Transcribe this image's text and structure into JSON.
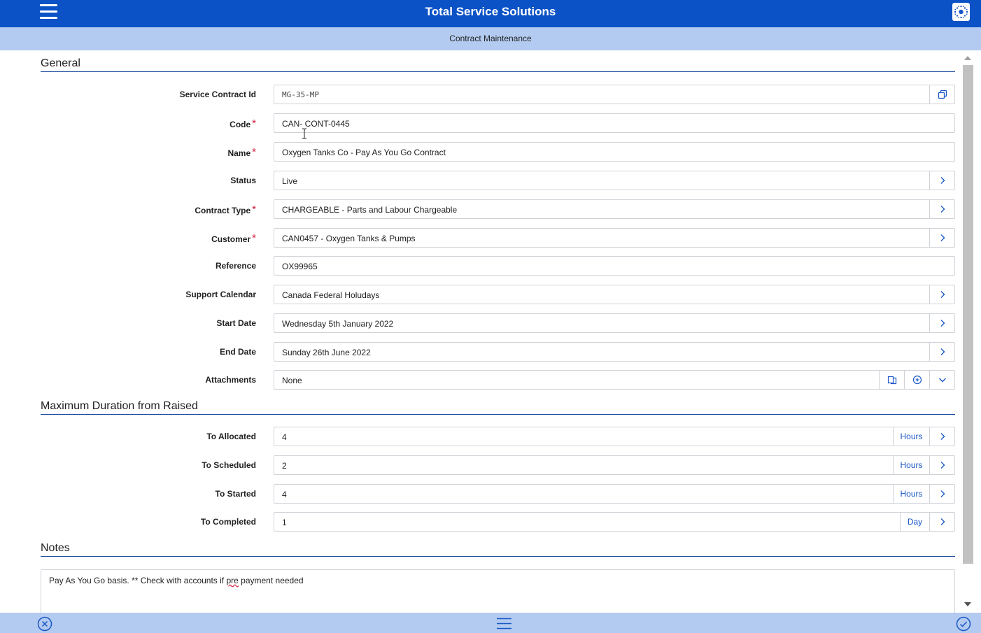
{
  "header": {
    "app_title": "Total Service Solutions",
    "logo_icon": "app-logo-icon",
    "menu_icon": "hamburger-menu-icon"
  },
  "subheader": {
    "title": "Contract Maintenance"
  },
  "sections": {
    "general": "General",
    "max_duration": "Maximum Duration from Raised",
    "notes": "Notes"
  },
  "general_fields": [
    {
      "label": "Service Contract Id",
      "value": "MG-35-MP",
      "required": false
    },
    {
      "label": "Code",
      "value": "CAN- CONT-0445",
      "required": true
    },
    {
      "label": "Name",
      "value": "Oxygen Tanks Co - Pay As You Go Contract",
      "required": true
    },
    {
      "label": "Status",
      "value": "Live",
      "required": false
    },
    {
      "label": "Contract Type",
      "value": "CHARGEABLE - Parts and Labour Chargeable",
      "required": true
    },
    {
      "label": "Customer",
      "value": "CAN0457 - Oxygen Tanks & Pumps",
      "required": true
    },
    {
      "label": "Reference",
      "value": "OX99965",
      "required": false
    },
    {
      "label": "Support Calendar",
      "value": "Canada Federal Holudays",
      "required": false
    },
    {
      "label": "Start Date",
      "value": "Wednesday 5th January 2022",
      "required": false
    },
    {
      "label": "End Date",
      "value": "Sunday 26th June 2022",
      "required": false
    },
    {
      "label": "Attachments",
      "value": "None",
      "required": false
    }
  ],
  "required_marker": "*",
  "duration_fields": [
    {
      "label": "To Allocated",
      "value": "4",
      "unit": "Hours"
    },
    {
      "label": "To Scheduled",
      "value": "2",
      "unit": "Hours"
    },
    {
      "label": "To Started",
      "value": "4",
      "unit": "Hours"
    },
    {
      "label": "To Completed",
      "value": "1",
      "unit": "Day"
    }
  ],
  "notes": {
    "before": "Pay As You Go basis. ** Check with accounts if ",
    "misspelled": "pre",
    "after": " payment needed"
  },
  "colors": {
    "primary": "#0a52c6",
    "subbar": "#b3cbf0",
    "required": "#d0203c",
    "link": "#1a57c6"
  }
}
